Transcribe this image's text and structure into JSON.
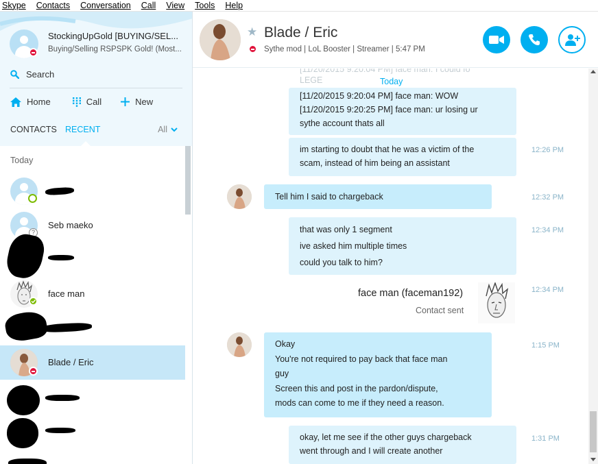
{
  "menu": [
    "Skype",
    "Contacts",
    "Conversation",
    "Call",
    "View",
    "Tools",
    "Help"
  ],
  "me": {
    "name": "StockingUpGold [BUYING/SEL...",
    "mood": "Buying/Selling RSPSPK Gold! (Most..."
  },
  "sidebar": {
    "search_label": "Search",
    "nav": {
      "home": "Home",
      "call": "Call",
      "new": "New"
    },
    "tabs": {
      "contacts": "CONTACTS",
      "recent": "RECENT",
      "filter": "All"
    },
    "section": "Today",
    "contacts": [
      {
        "name": "",
        "status": "away"
      },
      {
        "name": "Seb maeko",
        "status": "unknown"
      },
      {
        "name": "",
        "status": ""
      },
      {
        "name": "face man",
        "status": "online"
      },
      {
        "name": "",
        "status": ""
      },
      {
        "name": "Blade / Eric",
        "status": "dnd",
        "selected": true
      },
      {
        "name": "",
        "status": ""
      },
      {
        "name": "",
        "status": ""
      }
    ]
  },
  "conversation": {
    "name": "Blade / Eric",
    "mood": "Sythe mod | LoL Booster | Streamer  |  5:47 PM",
    "day_label": "Today",
    "faded_lines": [
      "[11/20/2015 9:20:04 PM] face man: I could fo",
      "LEGE"
    ],
    "messages": [
      {
        "from": "me",
        "lines": [
          "[11/20/2015 9:20:04 PM] face man: WOW",
          "[11/20/2015 9:20:25 PM] face man: ur losing ur",
          "sythe account thats all"
        ],
        "time": ""
      },
      {
        "from": "me",
        "lines": [
          "im starting to doubt that he was a victim of the",
          "scam, instead of him being an assistant"
        ],
        "time": "12:26 PM"
      },
      {
        "from": "them",
        "lines": [
          "Tell him I said to chargeback"
        ],
        "time": "12:32 PM"
      },
      {
        "from": "me",
        "lines": [
          "that was only 1 segment",
          "ive asked him multiple times",
          "could you talk to him?"
        ],
        "time": "12:34 PM"
      },
      {
        "from": "them",
        "lines": [
          "Okay",
          "You're not required to pay back that face man",
          "guy",
          "Screen this and post in the pardon/dispute,",
          "mods can come to me if they need a reason."
        ],
        "time": "1:15 PM"
      },
      {
        "from": "me",
        "lines": [
          "okay, let me see if the other guys chargeback",
          "went through and I will create another"
        ],
        "time": "1:31 PM"
      }
    ],
    "contact_card": {
      "name": "face man (faceman192)",
      "subtitle": "Contact sent",
      "time": "12:34 PM"
    }
  },
  "colors": {
    "accent": "#00aff0",
    "incoming_bubble": "#c7edfc",
    "outgoing_bubble": "#def3fc",
    "selected_row": "#c6e7f8"
  }
}
